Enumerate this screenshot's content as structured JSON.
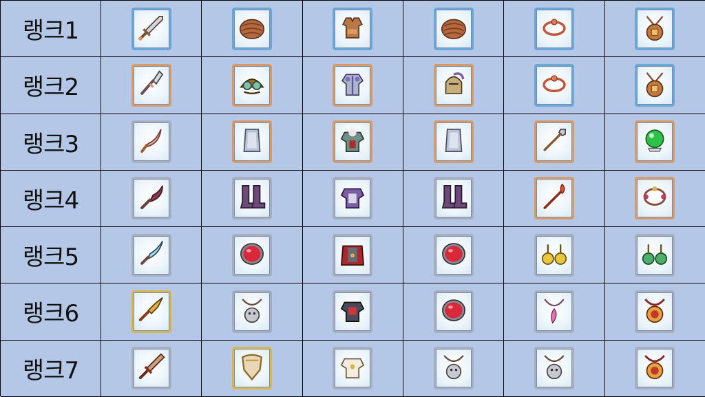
{
  "frame_colors": {
    "blue": "#6aa7d9",
    "copper": "#d99a66",
    "silver": "#a7aec0",
    "gold": "#d8b64e"
  },
  "rows": [
    {
      "label": "랭크1",
      "items": [
        {
          "icon": "sword-icon",
          "frame": "blue"
        },
        {
          "icon": "helmet-cap-icon",
          "frame": "blue"
        },
        {
          "icon": "leather-armor-icon",
          "frame": "blue"
        },
        {
          "icon": "helmet-cap-icon",
          "frame": "blue"
        },
        {
          "icon": "bracelet-icon",
          "frame": "blue"
        },
        {
          "icon": "amulet-icon",
          "frame": "blue"
        }
      ]
    },
    {
      "label": "랭크2",
      "items": [
        {
          "icon": "spear-blade-icon",
          "frame": "copper"
        },
        {
          "icon": "goggle-cap-icon",
          "frame": "copper"
        },
        {
          "icon": "plate-armor-icon",
          "frame": "copper"
        },
        {
          "icon": "knight-helmet-icon",
          "frame": "copper"
        },
        {
          "icon": "bracelet-icon",
          "frame": "blue"
        },
        {
          "icon": "amulet-icon",
          "frame": "blue"
        }
      ]
    },
    {
      "label": "랭크3",
      "items": [
        {
          "icon": "scimitar-icon",
          "frame": "silver"
        },
        {
          "icon": "shield-icon",
          "frame": "copper"
        },
        {
          "icon": "heavy-armor-icon",
          "frame": "copper"
        },
        {
          "icon": "shield-icon",
          "frame": "copper"
        },
        {
          "icon": "spear-icon",
          "frame": "copper"
        },
        {
          "icon": "crystal-orb-icon",
          "frame": "copper"
        }
      ]
    },
    {
      "label": "랭크4",
      "items": [
        {
          "icon": "curved-blade-icon",
          "frame": "silver"
        },
        {
          "icon": "boots-icon",
          "frame": "silver"
        },
        {
          "icon": "purple-armor-icon",
          "frame": "silver"
        },
        {
          "icon": "boots-icon",
          "frame": "silver"
        },
        {
          "icon": "flame-spear-icon",
          "frame": "copper"
        },
        {
          "icon": "bead-bracelet-icon",
          "frame": "copper"
        }
      ]
    },
    {
      "label": "랭크5",
      "items": [
        {
          "icon": "dagger-icon",
          "frame": "silver"
        },
        {
          "icon": "red-gem-icon",
          "frame": "silver"
        },
        {
          "icon": "caped-armor-icon",
          "frame": "silver"
        },
        {
          "icon": "red-gem-icon",
          "frame": "silver"
        },
        {
          "icon": "gold-earrings-icon",
          "frame": "silver"
        },
        {
          "icon": "green-earrings-icon",
          "frame": "silver"
        }
      ]
    },
    {
      "label": "랭크6",
      "items": [
        {
          "icon": "golden-sword-icon",
          "frame": "gold"
        },
        {
          "icon": "lion-pendant-icon",
          "frame": "silver"
        },
        {
          "icon": "dark-armor-icon",
          "frame": "silver"
        },
        {
          "icon": "red-gem-icon",
          "frame": "silver"
        },
        {
          "icon": "feather-necklace-icon",
          "frame": "silver"
        },
        {
          "icon": "medallion-necklace-icon",
          "frame": "silver"
        }
      ]
    },
    {
      "label": "랭크7",
      "items": [
        {
          "icon": "greatsword-icon",
          "frame": "silver"
        },
        {
          "icon": "golden-shield-icon",
          "frame": "gold"
        },
        {
          "icon": "white-armor-icon",
          "frame": "silver"
        },
        {
          "icon": "lion-pendant-icon",
          "frame": "silver"
        },
        {
          "icon": "lion-pendant-icon",
          "frame": "silver"
        },
        {
          "icon": "medallion-necklace-icon",
          "frame": "silver"
        }
      ]
    }
  ]
}
